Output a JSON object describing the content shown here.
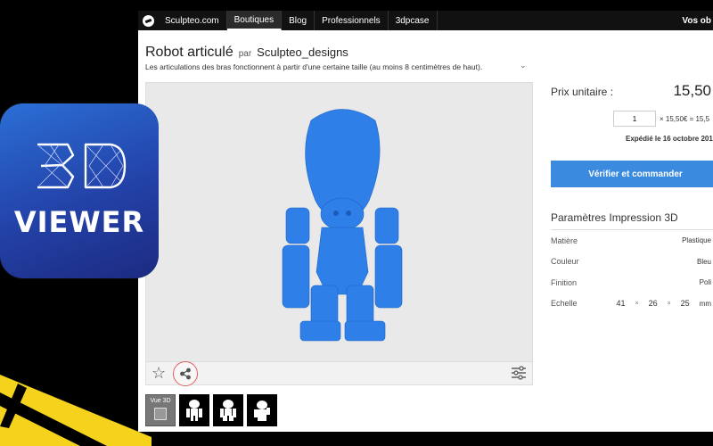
{
  "nav": {
    "items": [
      "Sculpteo.com",
      "Boutiques",
      "Blog",
      "Professionnels",
      "3dpcase"
    ],
    "active_index": 1,
    "account": "Vos ob"
  },
  "product": {
    "title": "Robot articulé",
    "by": "par",
    "author": "Sculpteo_designs",
    "description": "Les articulations des bras fonctionnent à partir d'une certaine taille (au moins 8 centimètres de haut).",
    "model_color": "#2f7fe8"
  },
  "thumbnails": {
    "first_label": "Vue 3D",
    "count": 4
  },
  "pricing": {
    "unit_label": "Prix unitaire :",
    "unit_price": "15,50",
    "quantity": "1",
    "total": "× 15,50€ = 15,5",
    "shipping": "Expédié le 16 octobre 201",
    "order_button": "Vérifier et commander",
    "accent": "#3a8be0"
  },
  "params": {
    "title": "Paramètres Impression 3D",
    "rows": [
      {
        "key": "Matière",
        "value": "Plastique"
      },
      {
        "key": "Couleur",
        "value": "Bleu"
      },
      {
        "key": "Finition",
        "value": "Poli"
      }
    ],
    "scale_label": "Echelle",
    "scale_x": "41",
    "scale_y": "26",
    "scale_z": "25",
    "scale_unit": "mm",
    "times": "×"
  },
  "app_icon": {
    "line1": "3D",
    "line2": "VIEWER"
  }
}
